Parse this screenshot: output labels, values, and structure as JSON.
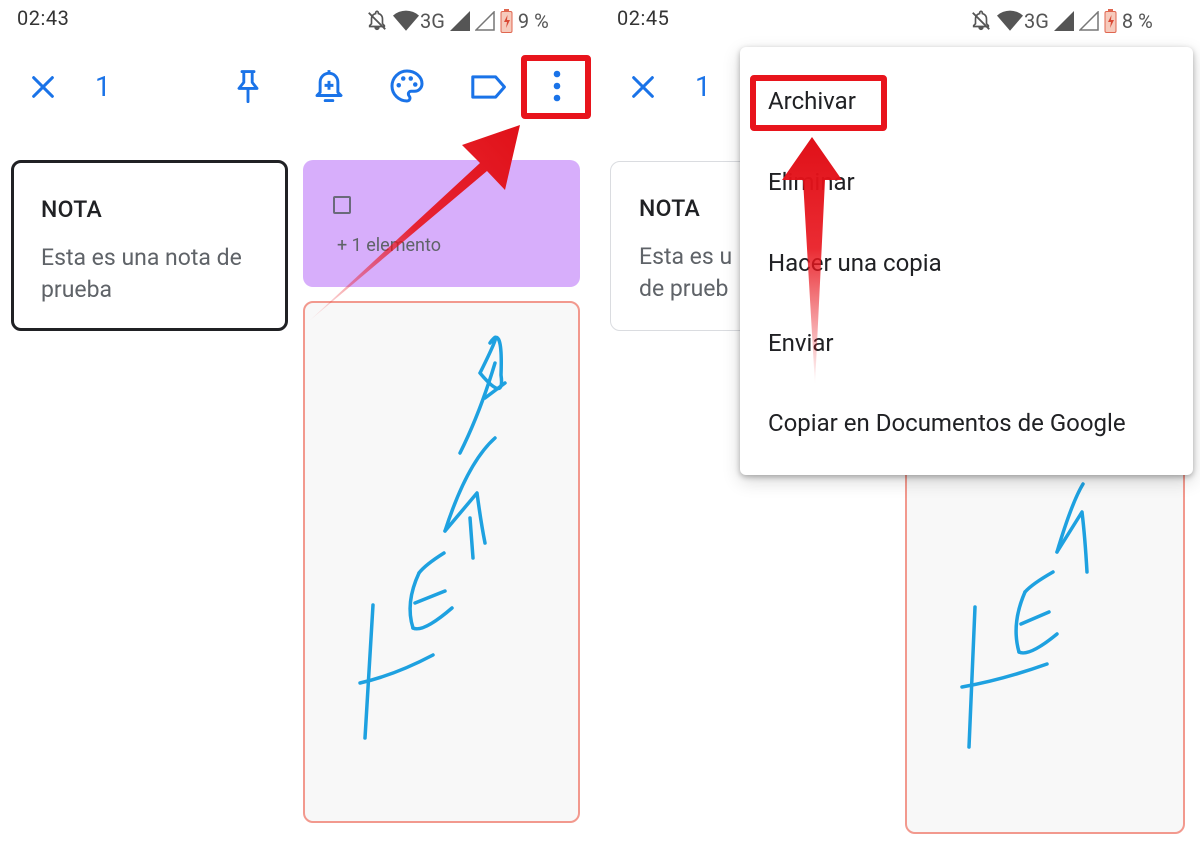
{
  "left": {
    "status": {
      "time": "02:43",
      "network": "3G",
      "battery": "9 %"
    },
    "toolbar": {
      "close_icon": "close-icon",
      "selected_count": "1",
      "actions": [
        "pin-icon",
        "reminder-bell-icon",
        "palette-icon",
        "label-icon",
        "more-vert-icon"
      ]
    },
    "notes": {
      "text_note": {
        "title": "NOTA",
        "body": "Esta es una nota de prueba"
      },
      "list_note": {
        "extra": "+ 1 elemento",
        "color": "#d7aefb"
      },
      "drawing_note": {
        "drawing_text": "TEAMO",
        "ink_color": "#1ea1e0"
      }
    }
  },
  "right": {
    "status": {
      "time": "02:45",
      "network": "3G",
      "battery": "8 %"
    },
    "toolbar": {
      "selected_count": "1"
    },
    "notes": {
      "text_note": {
        "title": "NOTA",
        "body_line1": "Esta es u",
        "body_line2": "de prueb"
      }
    },
    "menu": {
      "items": [
        "Archivar",
        "Eliminar",
        "Hacer una copia",
        "Enviar",
        "Copiar en Documentos de Google"
      ]
    }
  },
  "colors": {
    "accent": "#1a73e8",
    "annotation_red": "#e8141c",
    "selected_border": "#202124",
    "drawing_border": "#f2998e"
  }
}
